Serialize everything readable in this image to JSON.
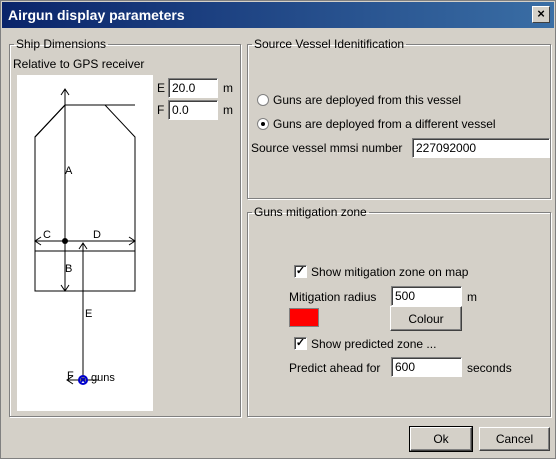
{
  "window": {
    "title": "Airgun display parameters",
    "close_label": "×"
  },
  "ship": {
    "group_label": "Ship Dimensions",
    "relative_label": "Relative to GPS receiver",
    "e_label": "E",
    "e_value": "20.0",
    "e_unit": "m",
    "f_label": "F",
    "f_value": "0.0",
    "f_unit": "m",
    "diagram": {
      "a": "A",
      "b": "B",
      "c": "C",
      "d": "D",
      "e": "E",
      "f": "F",
      "guns": "guns"
    }
  },
  "source": {
    "group_label": "Source Vessel Idenitification",
    "radio_this": "Guns are deployed from this vessel",
    "radio_other": "Guns are deployed from a different vessel",
    "selected": "other",
    "mmsi_label": "Source vessel mmsi number",
    "mmsi_value": "227092000"
  },
  "mitigation": {
    "group_label": "Guns mitigation zone",
    "show_zone_label": "Show mitigation zone on map",
    "show_zone_checked": true,
    "radius_label": "Mitigation radius",
    "radius_value": "500",
    "radius_unit": "m",
    "colour": "#ff0000",
    "colour_button": "Colour",
    "show_predicted_label": "Show predicted zone ...",
    "show_predicted_checked": true,
    "predict_label": "Predict ahead for",
    "predict_value": "600",
    "predict_unit": "seconds"
  },
  "buttons": {
    "ok": "Ok",
    "cancel": "Cancel"
  }
}
